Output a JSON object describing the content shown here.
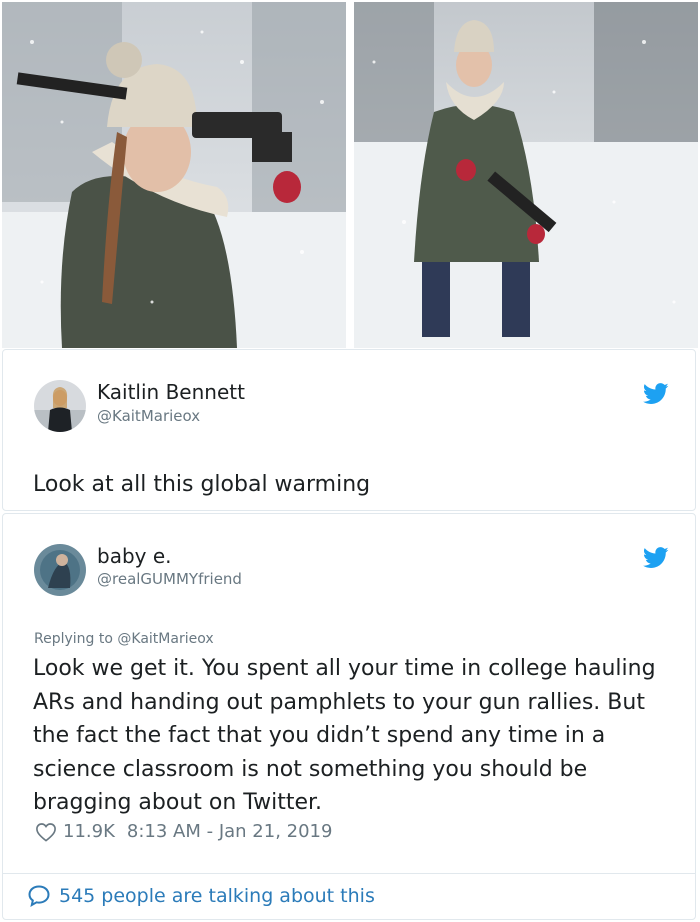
{
  "tweet1": {
    "name": "Kaitlin Bennett",
    "handle": "@KaitMarieox",
    "text": "Look at all this global warming"
  },
  "tweet2": {
    "name": "baby e.",
    "handle": "@realGUMMYfriend",
    "replying_prefix": "Replying to ",
    "replying_handle": "@KaitMarieox",
    "text": "Look we get it. You spent all your time in college hauling ARs and handing out pamphlets to your gun rallies. But the fact the fact that you didn’t spend any time in a science classroom is not something you should be bragging about on Twitter.",
    "likes": "11.9K",
    "timestamp": "8:13 AM - Jan 21, 2019",
    "talking": "545 people are talking about this"
  },
  "colors": {
    "twitter_blue": "#1da1f2",
    "link_blue": "#2b7bb9",
    "secondary_text": "#697882",
    "border": "#e1e8ed"
  },
  "icons": [
    "twitter-bird-icon",
    "heart-icon",
    "speech-bubble-icon"
  ]
}
